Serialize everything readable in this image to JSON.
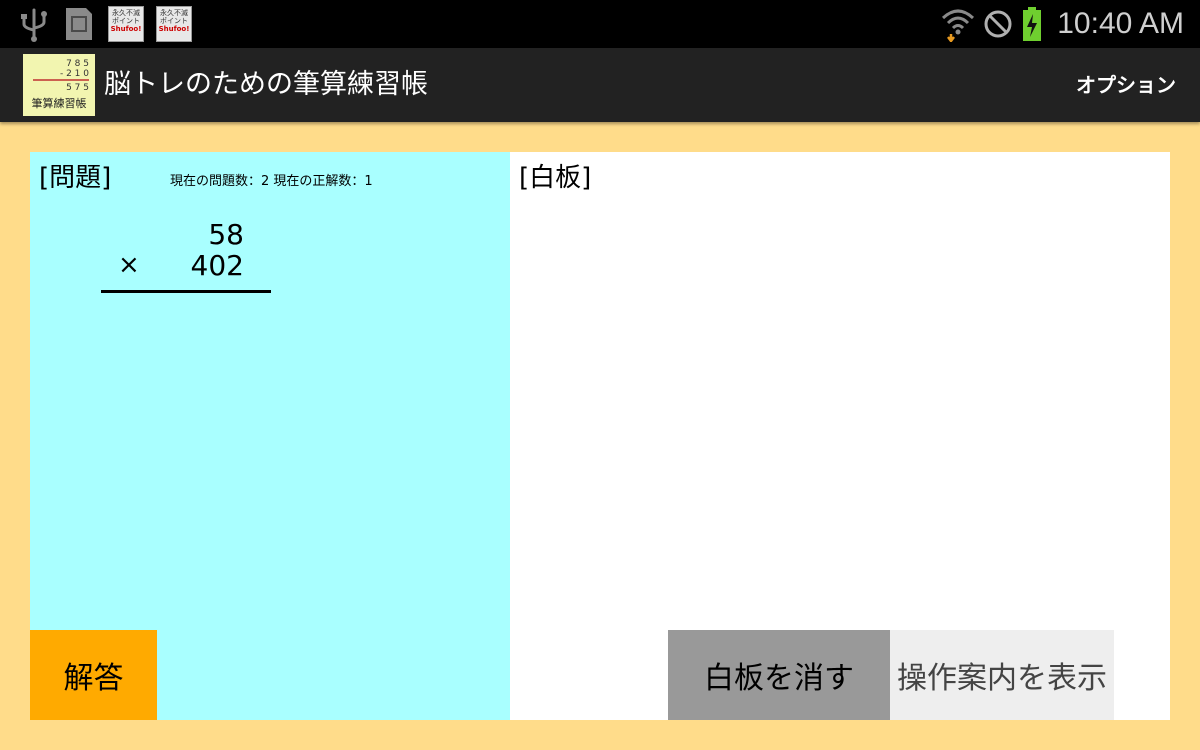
{
  "status_bar": {
    "time": "10:40 AM",
    "icons": [
      "usb-icon",
      "sd-card-icon",
      "notification-app-icon",
      "notification-app-icon",
      "wifi-icon",
      "do-not-disturb-icon",
      "battery-charging-icon"
    ],
    "notification_label_1": "永久不滅",
    "notification_label_2": "ポイント",
    "notification_label_3": "×",
    "notification_label_4": "Shufoo!"
  },
  "action_bar": {
    "app_icon": {
      "row1": "7 8 5",
      "row2": "- 2 1 0",
      "row3": "5 7 5",
      "label": "筆算練習帳"
    },
    "title": "脳トレのための筆算練習帳",
    "options_label": "オプション"
  },
  "problem_panel": {
    "heading": "[問題]",
    "stats": "現在の問題数：2  現在の正解数：1",
    "operand1": "58",
    "operator": "×",
    "operand2": "402",
    "answer_button": "解答",
    "background_color": "#A9FFFF",
    "answer_button_color": "#FFAA00"
  },
  "whiteboard_panel": {
    "heading": "[白板]",
    "clear_button": "白板を消す",
    "guide_button": "操作案内を表示"
  },
  "colors": {
    "page_background": "#FFDC8A",
    "action_bar": "#222222",
    "status_bar": "#000000"
  }
}
